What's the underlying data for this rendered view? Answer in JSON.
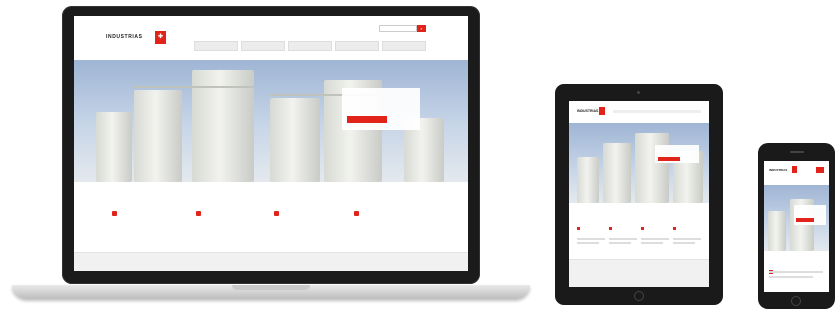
{
  "brand": {
    "logo_text": "INDUSTRIAS",
    "logo_sub": "",
    "badge_glyph": "✚",
    "accent": "#e2231a"
  },
  "desktop": {
    "top_links": "",
    "search_placeholder": "",
    "nav": [
      "",
      "",
      "",
      "",
      ""
    ],
    "hero": {
      "title": "",
      "button": ""
    },
    "features": [
      {
        "title": "",
        "text": ""
      },
      {
        "title": "",
        "text": ""
      },
      {
        "title": "",
        "text": ""
      },
      {
        "title": "",
        "text": ""
      }
    ],
    "footer_links": [
      "",
      "",
      "",
      ""
    ]
  },
  "tablet": {
    "logo_text": "INDUSTRIAS",
    "hero_title": "",
    "features": [
      "",
      "",
      "",
      ""
    ]
  },
  "phone": {
    "logo_text": "INDUSTRIAS",
    "hero_title": "",
    "feature_title": ""
  },
  "icons": {
    "search": "search-icon",
    "feature_1": "phone-icon",
    "feature_2": "document-icon",
    "feature_3": "info-icon",
    "feature_4": "gear-icon"
  }
}
